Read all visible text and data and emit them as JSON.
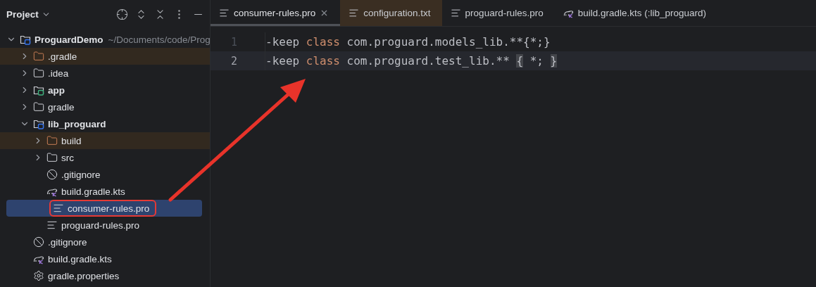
{
  "sidebar": {
    "title": "Project",
    "tree": [
      {
        "label": "ProguardDemo",
        "hint": "~/Documents/code/Prog",
        "kind": "project",
        "expanded": true,
        "selected": false,
        "excluded": false,
        "children": [
          {
            "label": ".gradle",
            "kind": "folder",
            "expanded": false,
            "selected": false,
            "excluded": true
          },
          {
            "label": ".idea",
            "kind": "folder",
            "expanded": false,
            "selected": false,
            "excluded": false
          },
          {
            "label": "app",
            "kind": "app-module",
            "expanded": false,
            "selected": false,
            "excluded": false
          },
          {
            "label": "gradle",
            "kind": "folder",
            "expanded": false,
            "selected": false,
            "excluded": false
          },
          {
            "label": "lib_proguard",
            "kind": "library-module",
            "expanded": true,
            "selected": false,
            "excluded": false,
            "children": [
              {
                "label": "build",
                "kind": "folder",
                "expanded": false,
                "selected": false,
                "excluded": true
              },
              {
                "label": "src",
                "kind": "folder",
                "expanded": false,
                "selected": false,
                "excluded": false
              },
              {
                "label": ".gitignore",
                "kind": "ignore-file",
                "selected": false,
                "excluded": false
              },
              {
                "label": "build.gradle.kts",
                "kind": "gradle-file",
                "selected": false,
                "excluded": false
              },
              {
                "label": "consumer-rules.pro",
                "kind": "text-file",
                "selected": true,
                "excluded": false,
                "annotated": true
              },
              {
                "label": "proguard-rules.pro",
                "kind": "text-file",
                "selected": false,
                "excluded": false
              }
            ]
          },
          {
            "label": ".gitignore",
            "kind": "ignore-file",
            "selected": false,
            "excluded": false
          },
          {
            "label": "build.gradle.kts",
            "kind": "gradle-file",
            "selected": false,
            "excluded": false
          },
          {
            "label": "gradle.properties",
            "kind": "properties-file",
            "selected": false,
            "excluded": false
          }
        ]
      }
    ]
  },
  "tabs": [
    {
      "label": "consumer-rules.pro",
      "kind": "text-file",
      "selected": true,
      "excluded": false
    },
    {
      "label": "configuration.txt",
      "kind": "text-file",
      "selected": false,
      "excluded": true
    },
    {
      "label": "proguard-rules.pro",
      "kind": "text-file",
      "selected": false,
      "excluded": false
    },
    {
      "label": "build.gradle.kts (:lib_proguard)",
      "kind": "gradle-file",
      "selected": false,
      "excluded": false
    }
  ],
  "editor": {
    "lines": [
      {
        "number": "1",
        "current": false,
        "tokens": [
          {
            "text": "-keep ",
            "kind": "plain"
          },
          {
            "text": "class",
            "kind": "keyword"
          },
          {
            "text": " com.proguard.models_lib.**{*;}",
            "kind": "plain"
          }
        ]
      },
      {
        "number": "2",
        "current": true,
        "tokens": [
          {
            "text": "-keep ",
            "kind": "plain"
          },
          {
            "text": "class",
            "kind": "keyword"
          },
          {
            "text": " com.proguard.test_lib.** ",
            "kind": "plain"
          },
          {
            "text": "{",
            "kind": "brace-match"
          },
          {
            "text": " *; ",
            "kind": "plain"
          },
          {
            "text": "}",
            "kind": "brace-match"
          }
        ]
      }
    ]
  }
}
